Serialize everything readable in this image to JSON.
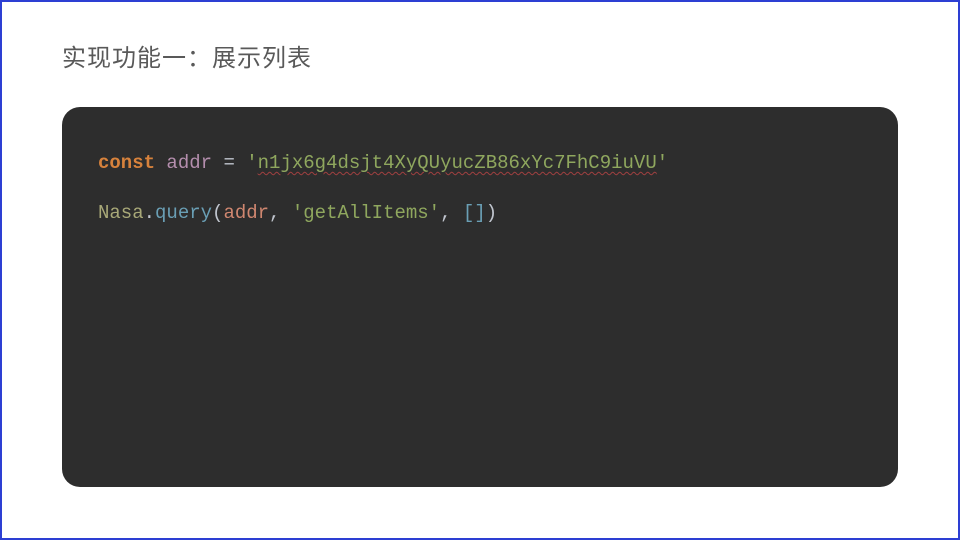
{
  "title": "实现功能一：展示列表",
  "code": {
    "line1": {
      "keyword": "const",
      "space1": " ",
      "varname": "addr",
      "space2": " ",
      "assign": "=",
      "space3": " ",
      "quote_open": "'",
      "string_body": "n1jx6g4dsjt4XyQUyucZB86xYc7FhC9iuVU",
      "quote_close": "'"
    },
    "line2": {
      "object": "Nasa",
      "dot": ".",
      "method": "query",
      "paren_open": "(",
      "arg1": "addr",
      "comma1": ",",
      "space1": " ",
      "arg2": "'getAllItems'",
      "comma2": ",",
      "space2": " ",
      "bracket_open": "[",
      "bracket_close": "]",
      "paren_close": ")"
    }
  }
}
